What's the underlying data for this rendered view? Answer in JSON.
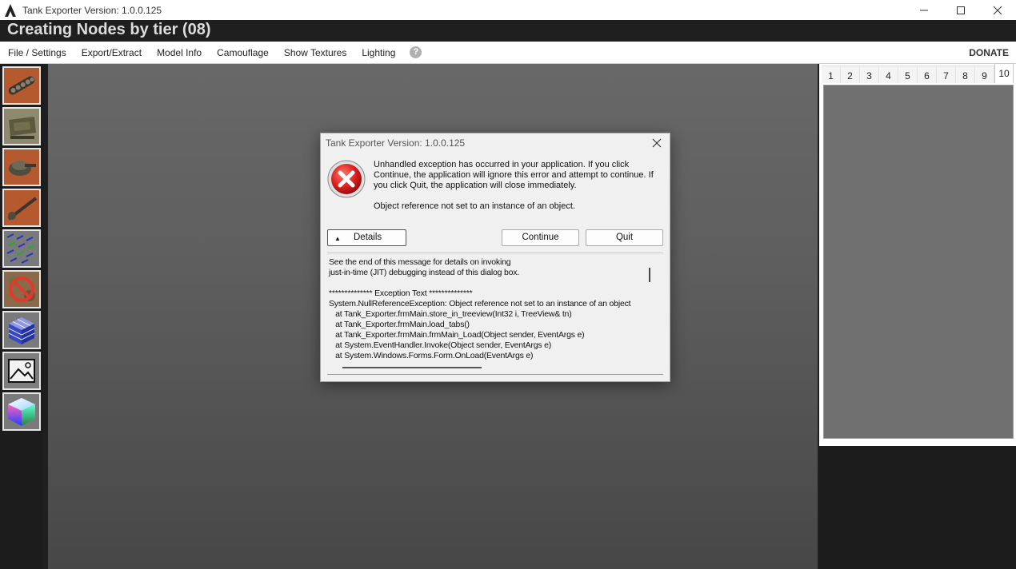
{
  "window": {
    "title": "Tank Exporter Version: 1.0.0.125"
  },
  "header": {
    "status": "Creating Nodes by tier (08)"
  },
  "menu": {
    "items": [
      "File / Settings",
      "Export/Extract",
      "Model Info",
      "Camouflage",
      "Show Textures",
      "Lighting"
    ],
    "help_glyph": "?",
    "donate": "DONATE"
  },
  "toolbar": {
    "icons": [
      "tank-chassis-icon",
      "tank-hull-icon",
      "tank-turret-icon",
      "tank-gun-icon",
      "wireframe-normals-icon",
      "no-camo-icon",
      "cube-grid-icon",
      "image-icon",
      "color-cube-icon"
    ]
  },
  "tiers": {
    "tabs": [
      "1",
      "2",
      "3",
      "4",
      "5",
      "6",
      "7",
      "8",
      "9",
      "10"
    ],
    "active": "10"
  },
  "dialog": {
    "title": "Tank Exporter Version: 1.0.0.125",
    "message_lines": [
      "Unhandled exception has occurred in your application. If you click",
      "Continue, the application will ignore this error and attempt to continue. If",
      "you click Quit, the application will close immediately."
    ],
    "message2": "Object reference not set to an instance of an object.",
    "details_label": "Details",
    "details_arrow": "▲",
    "continue_label": "Continue",
    "quit_label": "Quit",
    "details_lines": [
      "See the end of this message for details on invoking",
      "just-in-time (JIT) debugging instead of this dialog box.",
      "",
      "************** Exception Text **************",
      "System.NullReferenceException: Object reference not set to an instance of an object",
      "   at Tank_Exporter.frmMain.store_in_treeview(Int32 i, TreeView& tn)",
      "   at Tank_Exporter.frmMain.load_tabs()",
      "   at Tank_Exporter.frmMain.frmMain_Load(Object sender, EventArgs e)",
      "   at System.EventHandler.Invoke(Object sender, EventArgs e)",
      "   at System.Windows.Forms.Form.OnLoad(EventArgs e)"
    ]
  }
}
